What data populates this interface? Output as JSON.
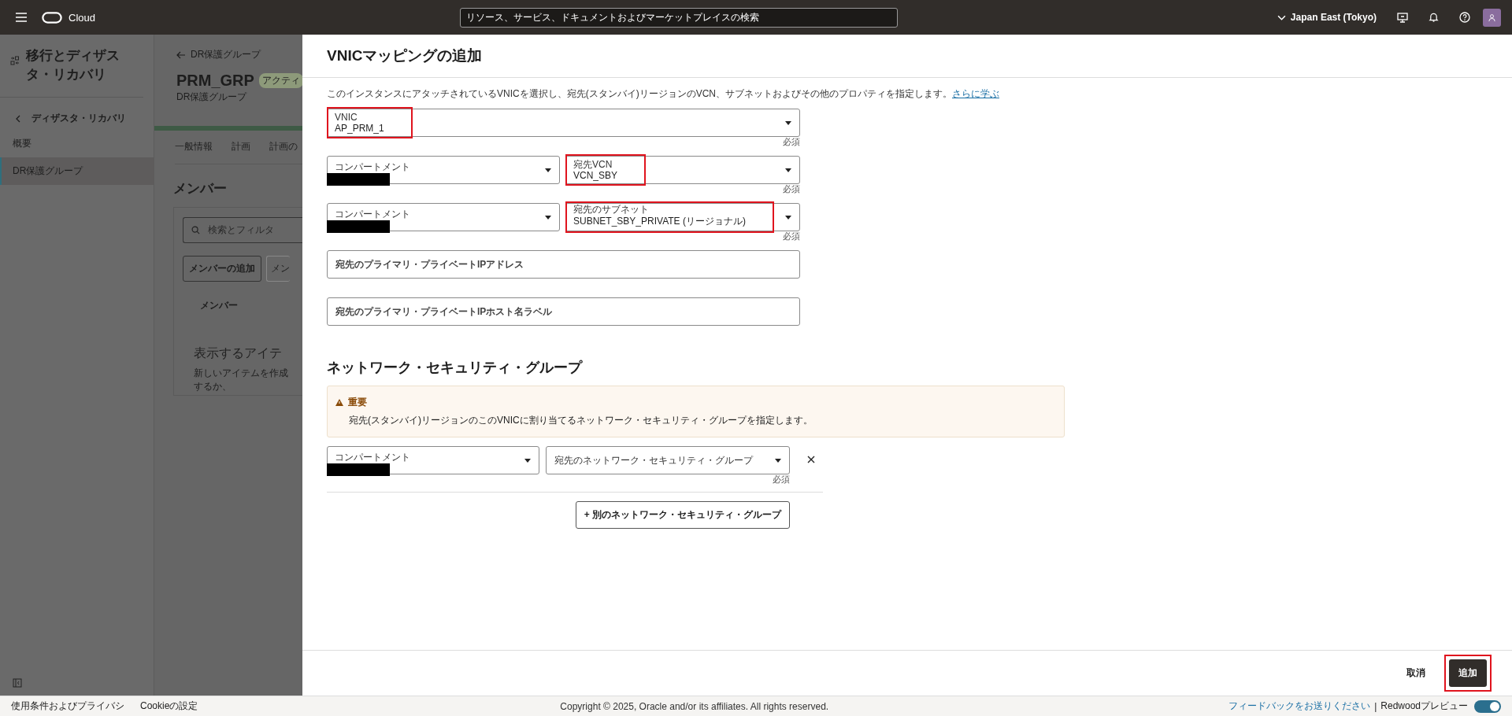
{
  "top_bar": {
    "brand": "Cloud",
    "search": {
      "placeholder": "リソース、サービス、ドキュメントおよびマーケットプレイスの検索"
    },
    "region": "Japan East (Tokyo)"
  },
  "sidebar": {
    "title": "移行とディザスタ・リカバリ",
    "back_link": "ディザスタ・リカバリ",
    "items": [
      {
        "label": "概要",
        "selected": false
      },
      {
        "label": "DR保護グループ",
        "selected": true
      }
    ]
  },
  "background_page": {
    "breadcrumb": "DR保護グループ",
    "title": "PRM_GRP",
    "status_badge": "アクティ",
    "subtitle": "DR保護グループ",
    "tabs": [
      "一般情報",
      "計画",
      "計画の"
    ],
    "section_title": "メンバー",
    "search": {
      "placeholder": "検索とフィルタ"
    },
    "buttons": [
      {
        "label": "メンバーの追加",
        "disabled": false
      },
      {
        "label": "メン",
        "disabled": true
      }
    ],
    "column": "メンバー",
    "empty_title": "表示するアイテ",
    "empty_text": "新しいアイテムを作成するか、"
  },
  "panel": {
    "title": "VNICマッピングの追加",
    "description": "このインスタンスにアタッチされているVNICを選択し、宛先(スタンバイ)リージョンのVCN、サブネットおよびその他のプロパティを指定します。",
    "learn_more": "さらに学ぶ",
    "rows": [
      [
        {
          "kind": "select",
          "label": "VNIC",
          "value": "AP_PRM_1",
          "highlighted": true,
          "required": "必須"
        }
      ],
      [
        {
          "kind": "select",
          "label": "コンパートメント",
          "redacted": true,
          "highlighted": false
        },
        {
          "kind": "select",
          "label": "宛先VCN",
          "value": "VCN_SBY",
          "highlighted": true,
          "required": "必須"
        }
      ],
      [
        {
          "kind": "select",
          "label": "コンパートメント",
          "redacted": true,
          "highlighted": false
        },
        {
          "kind": "select",
          "label": "宛先のサブネット",
          "value": "SUBNET_SBY_PRIVATE (リージョナル)",
          "highlighted": true,
          "required": "必須"
        }
      ],
      [
        {
          "kind": "text",
          "placeholder": "宛先のプライマリ・プライベートIPアドレス"
        }
      ],
      [
        {
          "kind": "text",
          "placeholder": "宛先のプライマリ・プライベートIPホスト名ラベル"
        }
      ]
    ],
    "nsg": {
      "title": "ネットワーク・セキュリティ・グループ",
      "notice": {
        "heading": "重要",
        "text": "宛先(スタンバイ)リージョンのこのVNICに割り当てるネットワーク・セキュリティ・グループを指定します。"
      },
      "fields": [
        {
          "kind": "select",
          "label": "コンパートメント",
          "redacted": true,
          "highlighted": false
        },
        {
          "kind": "select",
          "placeholder": "宛先のネットワーク・セキュリティ・グループ",
          "required": "必須"
        }
      ],
      "add_button": "+ 別のネットワーク・セキュリティ・グループ"
    },
    "cancel": "取消",
    "submit": {
      "label": "追加",
      "highlighted": true
    }
  },
  "footer": {
    "links": [
      "使用条件およびプライバシ",
      "Cookieの設定"
    ],
    "copyright": "Copyright © 2025, Oracle and/or its affiliates. All rights reserved.",
    "feedback": "フィードバックをお送りください",
    "separator": "|",
    "preview": "Redwoodプレビュー",
    "preview_on": true
  }
}
